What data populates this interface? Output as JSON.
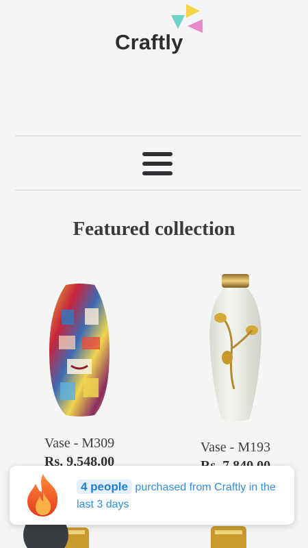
{
  "brand": {
    "name": "Craftly"
  },
  "nav": {
    "menu_icon": "hamburger-menu-icon"
  },
  "section": {
    "title": "Featured collection"
  },
  "products": [
    {
      "name": "Vase - M309",
      "price": "Rs. 9,548.00"
    },
    {
      "name": "Vase - M193",
      "price": "Rs. 7,840.00"
    }
  ],
  "popup": {
    "icon": "flame-icon",
    "count_text": "4 people",
    "message": "purchased from Craftly in the last 3 days"
  },
  "colors": {
    "accent": "#2f8de0",
    "background": "#f5f5f5",
    "logo_yellow": "#f5d54a",
    "logo_teal": "#6fd3c8",
    "logo_pink": "#e48ac9"
  }
}
